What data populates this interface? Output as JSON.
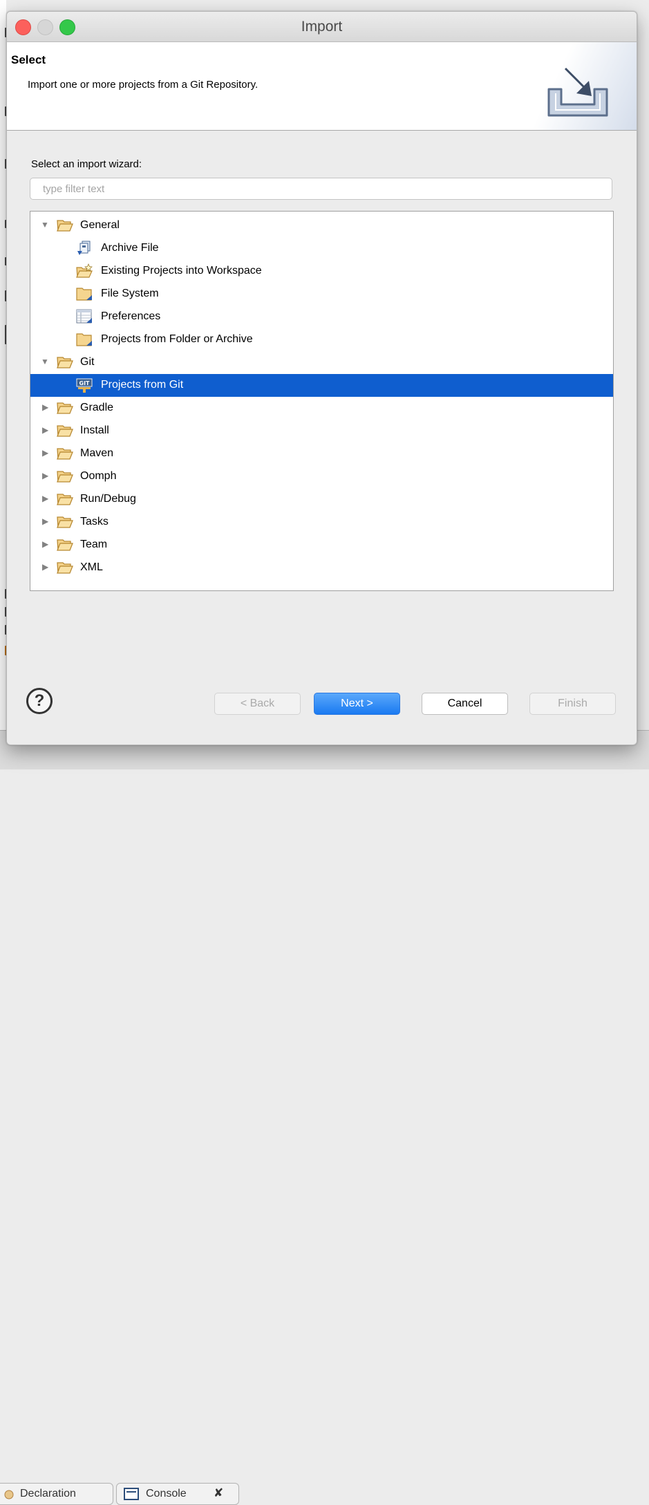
{
  "dialog": {
    "title": "Import",
    "header": {
      "heading": "Select",
      "description": "Import one or more projects from a Git Repository.",
      "icon": "import-wizard-icon"
    },
    "wizard_label": "Select an import wizard:",
    "filter": {
      "placeholder": "type filter text",
      "value": ""
    },
    "tree": [
      {
        "label": "General",
        "level": 0,
        "expanded": true,
        "icon": "folder-open-icon",
        "selected": false
      },
      {
        "label": "Archive File",
        "level": 1,
        "icon": "archive-file-icon",
        "selected": false
      },
      {
        "label": "Existing Projects into Workspace",
        "level": 1,
        "icon": "existing-projects-icon",
        "selected": false
      },
      {
        "label": "File System",
        "level": 1,
        "icon": "file-system-icon",
        "selected": false
      },
      {
        "label": "Preferences",
        "level": 1,
        "icon": "preferences-icon",
        "selected": false
      },
      {
        "label": "Projects from Folder or Archive",
        "level": 1,
        "icon": "projects-folder-icon",
        "selected": false
      },
      {
        "label": "Git",
        "level": 0,
        "expanded": true,
        "icon": "folder-open-icon",
        "selected": false
      },
      {
        "label": "Projects from Git",
        "level": 1,
        "icon": "git-icon",
        "selected": true
      },
      {
        "label": "Gradle",
        "level": 0,
        "expanded": false,
        "icon": "folder-open-icon",
        "selected": false
      },
      {
        "label": "Install",
        "level": 0,
        "expanded": false,
        "icon": "folder-open-icon",
        "selected": false
      },
      {
        "label": "Maven",
        "level": 0,
        "expanded": false,
        "icon": "folder-open-icon",
        "selected": false
      },
      {
        "label": "Oomph",
        "level": 0,
        "expanded": false,
        "icon": "folder-open-icon",
        "selected": false
      },
      {
        "label": "Run/Debug",
        "level": 0,
        "expanded": false,
        "icon": "folder-open-icon",
        "selected": false
      },
      {
        "label": "Tasks",
        "level": 0,
        "expanded": false,
        "icon": "folder-open-icon",
        "selected": false
      },
      {
        "label": "Team",
        "level": 0,
        "expanded": false,
        "icon": "folder-open-icon",
        "selected": false
      },
      {
        "label": "XML",
        "level": 0,
        "expanded": false,
        "icon": "folder-open-icon",
        "selected": false
      }
    ],
    "buttons": {
      "help_glyph": "?",
      "back": "< Back",
      "next": "Next >",
      "cancel": "Cancel",
      "finish": "Finish"
    }
  },
  "background": {
    "tabs": [
      {
        "label": "Declaration",
        "icon": "declaration-icon"
      },
      {
        "label": "Console",
        "icon": "console-icon",
        "close_glyph": "✘"
      }
    ]
  },
  "colors": {
    "selection": "#0f5ecf",
    "primary_button": "#1a7af1",
    "close_light": "#fc605c",
    "zoom_light": "#34c84a"
  }
}
